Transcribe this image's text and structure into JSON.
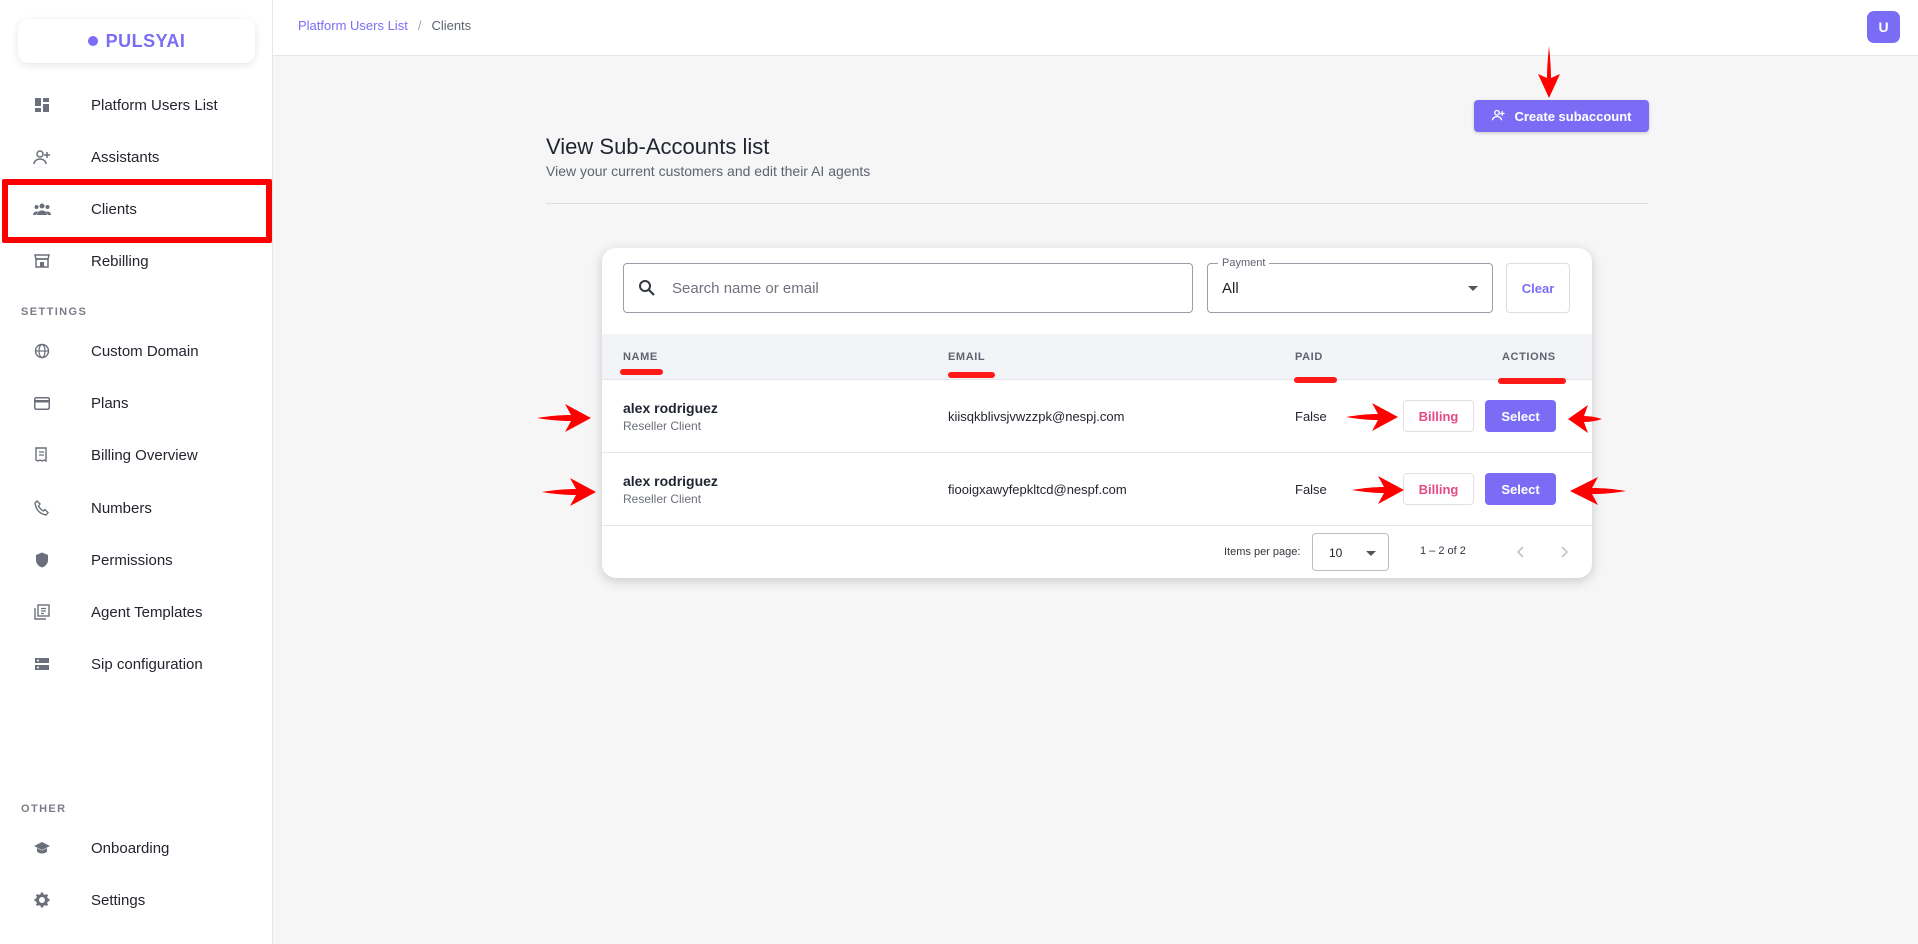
{
  "sidebar": {
    "logo": "PULSYAI",
    "items": [
      {
        "label": "Platform Users List",
        "icon": "dashboard-icon"
      },
      {
        "label": "Assistants",
        "icon": "person-add-icon"
      },
      {
        "label": "Clients",
        "icon": "group-icon"
      },
      {
        "label": "Rebilling",
        "icon": "storefront-icon"
      }
    ],
    "settings_title": "SETTINGS",
    "settings_items": [
      {
        "label": "Custom Domain",
        "icon": "globe-icon"
      },
      {
        "label": "Plans",
        "icon": "credit-card-icon"
      },
      {
        "label": "Billing Overview",
        "icon": "receipt-icon"
      },
      {
        "label": "Numbers",
        "icon": "phone-icon"
      },
      {
        "label": "Permissions",
        "icon": "shield-icon"
      },
      {
        "label": "Agent Templates",
        "icon": "library-icon"
      },
      {
        "label": "Sip configuration",
        "icon": "server-icon"
      }
    ],
    "other_title": "OTHER",
    "other_items": [
      {
        "label": "Onboarding",
        "icon": "school-icon"
      },
      {
        "label": "Settings",
        "icon": "gear-icon"
      }
    ]
  },
  "header": {
    "breadcrumb_link": "Platform Users List",
    "breadcrumb_sep": "/",
    "breadcrumb_current": "Clients",
    "avatar_initial": "U"
  },
  "main": {
    "create_button": "Create subaccount",
    "title": "View Sub-Accounts list",
    "subtitle": "View your current customers and edit their AI agents"
  },
  "filters": {
    "search_placeholder": "Search name or email",
    "payment_label": "Payment",
    "payment_value": "All",
    "clear_label": "Clear"
  },
  "table": {
    "columns": [
      "NAME",
      "EMAIL",
      "PAID",
      "ACTIONS"
    ],
    "rows": [
      {
        "name": "alex rodriguez",
        "role": "Reseller Client",
        "email": "kiisqkblivsjvwzzpk@nespj.com",
        "paid": "False",
        "billing": "Billing",
        "select": "Select"
      },
      {
        "name": "alex rodriguez",
        "role": "Reseller Client",
        "email": "fiooigxawyfepkltcd@nespf.com",
        "paid": "False",
        "billing": "Billing",
        "select": "Select"
      }
    ]
  },
  "pagination": {
    "items_per_page_label": "Items per page:",
    "items_per_page": "10",
    "range": "1 – 2 of 2"
  },
  "colors": {
    "accent": "#7b6cf6",
    "billing": "#e64a86",
    "annotation": "#ff0000"
  }
}
